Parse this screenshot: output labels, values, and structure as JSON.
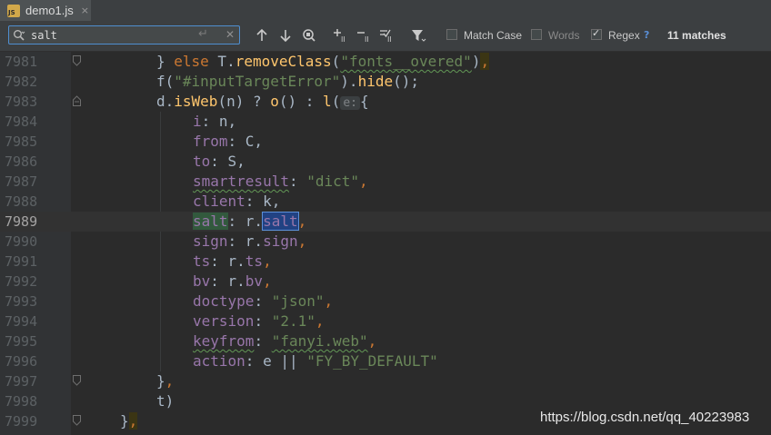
{
  "tab": {
    "icon_text": "JS",
    "label": "demo1.js",
    "close": "×"
  },
  "find": {
    "query": "salt",
    "newline_symbol": "↵",
    "clear_symbol": "✕",
    "match_case": {
      "label": "Match Case",
      "checked": false
    },
    "words": {
      "label": "Words",
      "checked": false
    },
    "regex": {
      "label": "Regex",
      "checked": true
    },
    "help": "?",
    "result": "11 matches"
  },
  "editor": {
    "current_line": "7989",
    "lines": [
      {
        "num": "7981"
      },
      {
        "num": "7982"
      },
      {
        "num": "7983"
      },
      {
        "num": "7984"
      },
      {
        "num": "7985"
      },
      {
        "num": "7986"
      },
      {
        "num": "7987"
      },
      {
        "num": "7988"
      },
      {
        "num": "7989"
      },
      {
        "num": "7990"
      },
      {
        "num": "7991"
      },
      {
        "num": "7992"
      },
      {
        "num": "7993"
      },
      {
        "num": "7994"
      },
      {
        "num": "7995"
      },
      {
        "num": "7996"
      },
      {
        "num": "7997"
      },
      {
        "num": "7998"
      },
      {
        "num": "7999"
      }
    ],
    "tokens": {
      "l1": [
        "} ",
        "else",
        " T.",
        "removeClass",
        "(",
        "\"fonts__overed\"",
        ")",
        ","
      ],
      "l2": [
        "f(",
        "\"#inputTargetError\"",
        ").",
        "hide",
        "();"
      ],
      "l3": [
        "d.",
        "isWeb",
        "(n) ? ",
        "o",
        "() : ",
        "l",
        "(",
        "e:",
        "{"
      ],
      "l4": [
        "i",
        ": n,"
      ],
      "l5": [
        "from",
        ": C,"
      ],
      "l6": [
        "to",
        ": S,"
      ],
      "l7": [
        "smartresult",
        ": ",
        "\"dict\"",
        ","
      ],
      "l8": [
        "client",
        ": k,"
      ],
      "l9": [
        "salt",
        ": r.",
        "salt",
        ","
      ],
      "l10": [
        "sign",
        ": r.",
        "sign",
        ","
      ],
      "l11": [
        "ts",
        ": r.",
        "ts",
        ","
      ],
      "l12": [
        "bv",
        ": r.",
        "bv",
        ","
      ],
      "l13": [
        "doctype",
        ": ",
        "\"json\"",
        ","
      ],
      "l14": [
        "version",
        ": ",
        "\"2.1\"",
        ","
      ],
      "l15": [
        "keyfrom",
        ": ",
        "\"fanyi.web\"",
        ","
      ],
      "l16": [
        "action",
        ": e || ",
        "\"FY_BY_DEFAULT\""
      ],
      "l17": [
        "}",
        ","
      ],
      "l18": [
        "t)"
      ],
      "l19": [
        "}",
        ","
      ]
    }
  },
  "watermark": "https://blog.csdn.net/qq_40223983"
}
